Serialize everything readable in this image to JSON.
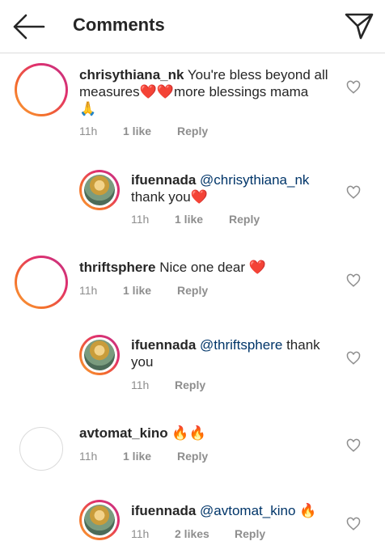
{
  "header": {
    "title": "Comments"
  },
  "comments": [
    {
      "username": "chrisythiana_nk",
      "text_line1": "You're bless beyond all",
      "text_line2a": "measures",
      "text_line2b": "❤️❤️",
      "text_line2c": "more blessings mama",
      "text_line3": "🙏",
      "time": "11h",
      "likes": "1 like",
      "reply": "Reply"
    },
    {
      "username": "ifuennada",
      "mention": "@chrisythiana_nk",
      "text_line2": "thank you",
      "emoji": "❤️",
      "time": "11h",
      "likes": "1 like",
      "reply": "Reply"
    },
    {
      "username": "thriftsphere",
      "text": "Nice one dear",
      "emoji": "❤️",
      "time": "11h",
      "likes": "1 like",
      "reply": "Reply"
    },
    {
      "username": "ifuennada",
      "mention": "@thriftsphere",
      "text_line1_end": "thank",
      "text_line2": "you",
      "time": "11h",
      "reply": "Reply"
    },
    {
      "username": "avtomat_kino",
      "emoji": "🔥🔥",
      "time": "11h",
      "likes": "1 like",
      "reply": "Reply"
    },
    {
      "username": "ifuennada",
      "mention": "@avtomat_kino",
      "emoji": "🔥",
      "time": "11h",
      "likes": "2 likes",
      "reply": "Reply"
    }
  ]
}
